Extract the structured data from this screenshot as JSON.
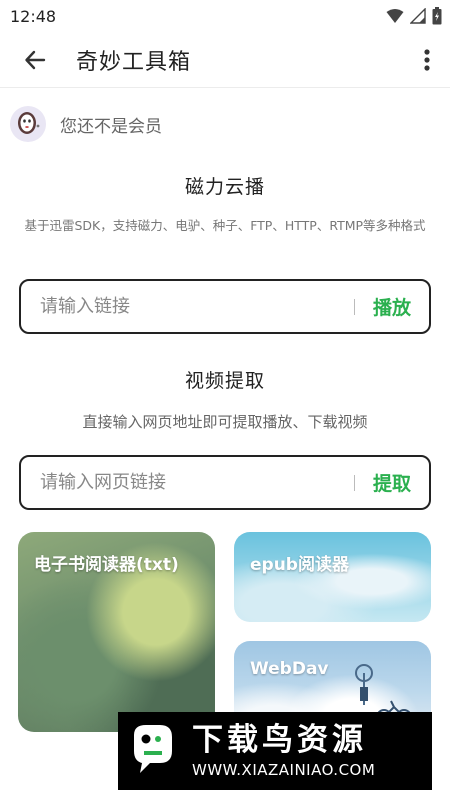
{
  "status_bar": {
    "time": "12:48"
  },
  "app_bar": {
    "title": "奇妙工具箱"
  },
  "member": {
    "text": "您还不是会员"
  },
  "magnet": {
    "title": "磁力云播",
    "description": "基于迅雷SDK，支持磁力、电驴、种子、FTP、HTTP、RTMP等多种格式",
    "input_placeholder": "请输入链接",
    "action_label": "播放"
  },
  "video": {
    "title": "视频提取",
    "description": "直接输入网页地址即可提取播放、下载视频",
    "input_placeholder": "请输入网页链接",
    "action_label": "提取"
  },
  "cards": [
    {
      "label": "电子书阅读器(txt)"
    },
    {
      "label": "epub阅读器"
    },
    {
      "label": "WebDav"
    }
  ],
  "watermark": {
    "title": "下载鸟资源",
    "url": "WWW.XIAZAINIAO.COM"
  },
  "colors": {
    "accent_green": "#2bb04f",
    "border_dark": "#222222"
  }
}
